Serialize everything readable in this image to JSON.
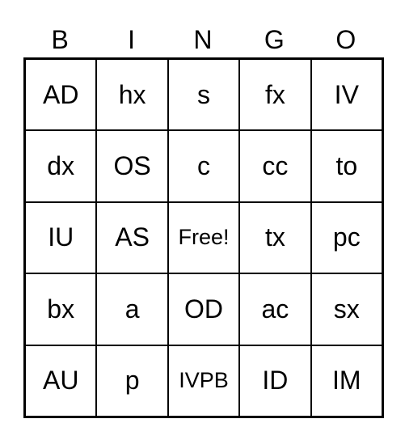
{
  "header": [
    "B",
    "I",
    "N",
    "G",
    "O"
  ],
  "rows": [
    [
      "AD",
      "hx",
      "s",
      "fx",
      "IV"
    ],
    [
      "dx",
      "OS",
      "c",
      "cc",
      "to"
    ],
    [
      "IU",
      "AS",
      "Free!",
      "tx",
      "pc"
    ],
    [
      "bx",
      "a",
      "OD",
      "ac",
      "sx"
    ],
    [
      "AU",
      "p",
      "IVPB",
      "ID",
      "IM"
    ]
  ]
}
